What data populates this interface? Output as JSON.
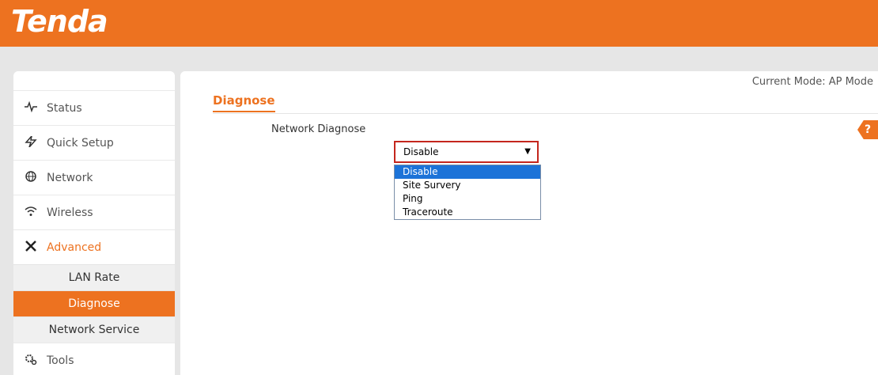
{
  "header": {
    "logo": "Tenda",
    "brand_color": "#ed7220"
  },
  "sidebar": {
    "items": [
      {
        "label": "Status",
        "icon": "pulse-icon"
      },
      {
        "label": "Quick Setup",
        "icon": "lightning-icon"
      },
      {
        "label": "Network",
        "icon": "globe-icon"
      },
      {
        "label": "Wireless",
        "icon": "wifi-icon"
      },
      {
        "label": "Advanced",
        "icon": "tools-icon"
      },
      {
        "label": "Tools",
        "icon": "gears-icon"
      }
    ],
    "sub_items": [
      {
        "label": "LAN Rate"
      },
      {
        "label": "Diagnose"
      },
      {
        "label": "Network Service"
      }
    ]
  },
  "main": {
    "mode": "Current Mode: AP Mode",
    "title": "Diagnose",
    "help": "?",
    "field_label": "Network Diagnose",
    "select_value": "Disable",
    "options": [
      "Disable",
      "Site Survery",
      "Ping",
      "Traceroute"
    ]
  }
}
